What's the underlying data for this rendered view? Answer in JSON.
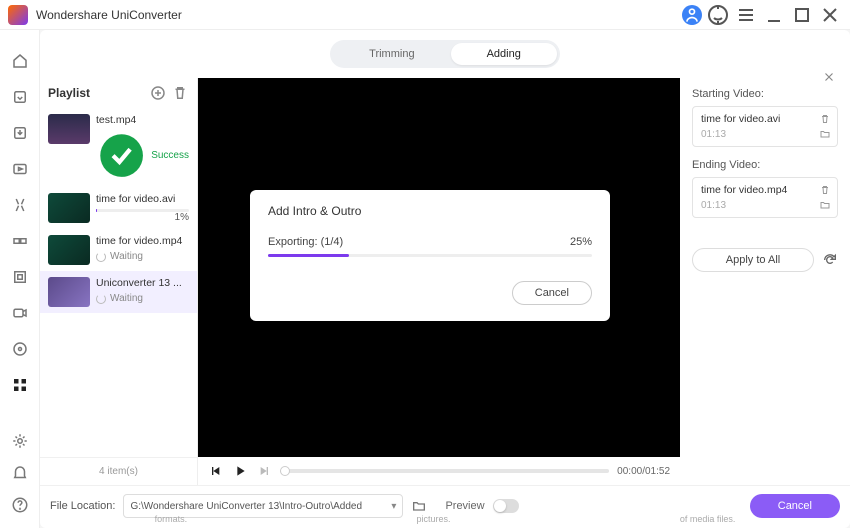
{
  "app": {
    "title": "Wondershare UniConverter"
  },
  "tabs": {
    "trimming": "Trimming",
    "adding": "Adding"
  },
  "playlist": {
    "title": "Playlist",
    "footer": "4 item(s)",
    "items": [
      {
        "name": "test.mp4",
        "status_label": "Success",
        "status": "ok"
      },
      {
        "name": "time for video.avi",
        "status_label": "1%",
        "status": "pct",
        "pct": 1
      },
      {
        "name": "time for video.mp4",
        "status_label": "Waiting",
        "status": "wait"
      },
      {
        "name": "Uniconverter 13 ...",
        "status_label": "Waiting",
        "status": "wait"
      }
    ]
  },
  "transport": {
    "time": "00:00/01:52"
  },
  "right": {
    "start_label": "Starting Video:",
    "end_label": "Ending Video:",
    "start": {
      "name": "time for video.avi",
      "time": "01:13"
    },
    "end": {
      "name": "time for video.mp4",
      "time": "01:13"
    },
    "apply": "Apply to All"
  },
  "footer": {
    "label": "File Location:",
    "path": "G:\\Wondershare UniConverter 13\\Intro-Outro\\Added",
    "preview": "Preview",
    "cancel": "Cancel"
  },
  "modal": {
    "title": "Add Intro & Outro",
    "status": "Exporting: (1/4)",
    "pct_label": "25%",
    "pct": 25,
    "cancel": "Cancel"
  },
  "footlinks": {
    "a": "formats.",
    "b": "pictures.",
    "c": "of media files."
  }
}
